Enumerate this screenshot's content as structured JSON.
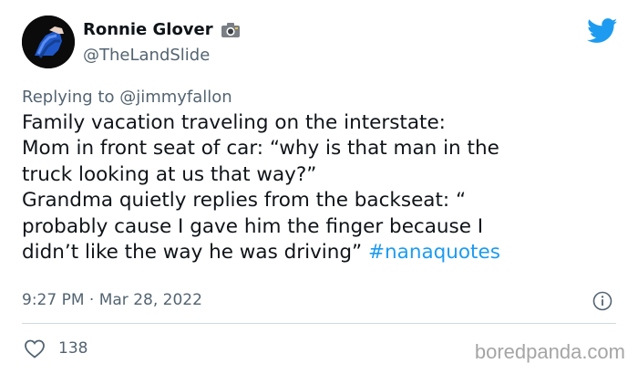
{
  "author": {
    "name": "Ronnie Glover",
    "handle": "@TheLandSlide",
    "name_badge_icon": "camera-icon",
    "avatar_icon": "boxing-hand-wrap-avatar"
  },
  "platform_icon": "twitter-bird-icon",
  "reply": {
    "prefix": "Replying to ",
    "to": "@jimmyfallon"
  },
  "tweet": {
    "text": "Family vacation traveling on the interstate:\nMom in front seat of car: “why is that man in the\ntruck looking at us that way?”\nGrandma quietly replies from the backseat: “\nprobably cause I gave him the finger because I\ndidn’t like the way he was driving” ",
    "hashtag": "#nanaquotes"
  },
  "meta": {
    "timestamp": "9:27 PM · Mar 28, 2022",
    "info_icon": "info-icon"
  },
  "actions": {
    "like_icon": "heart-icon",
    "like_count": "138"
  },
  "watermark": "boredpanda.com",
  "colors": {
    "accent": "#1d9bf0",
    "secondary_text": "#536471",
    "primary_text": "#0f1419"
  }
}
